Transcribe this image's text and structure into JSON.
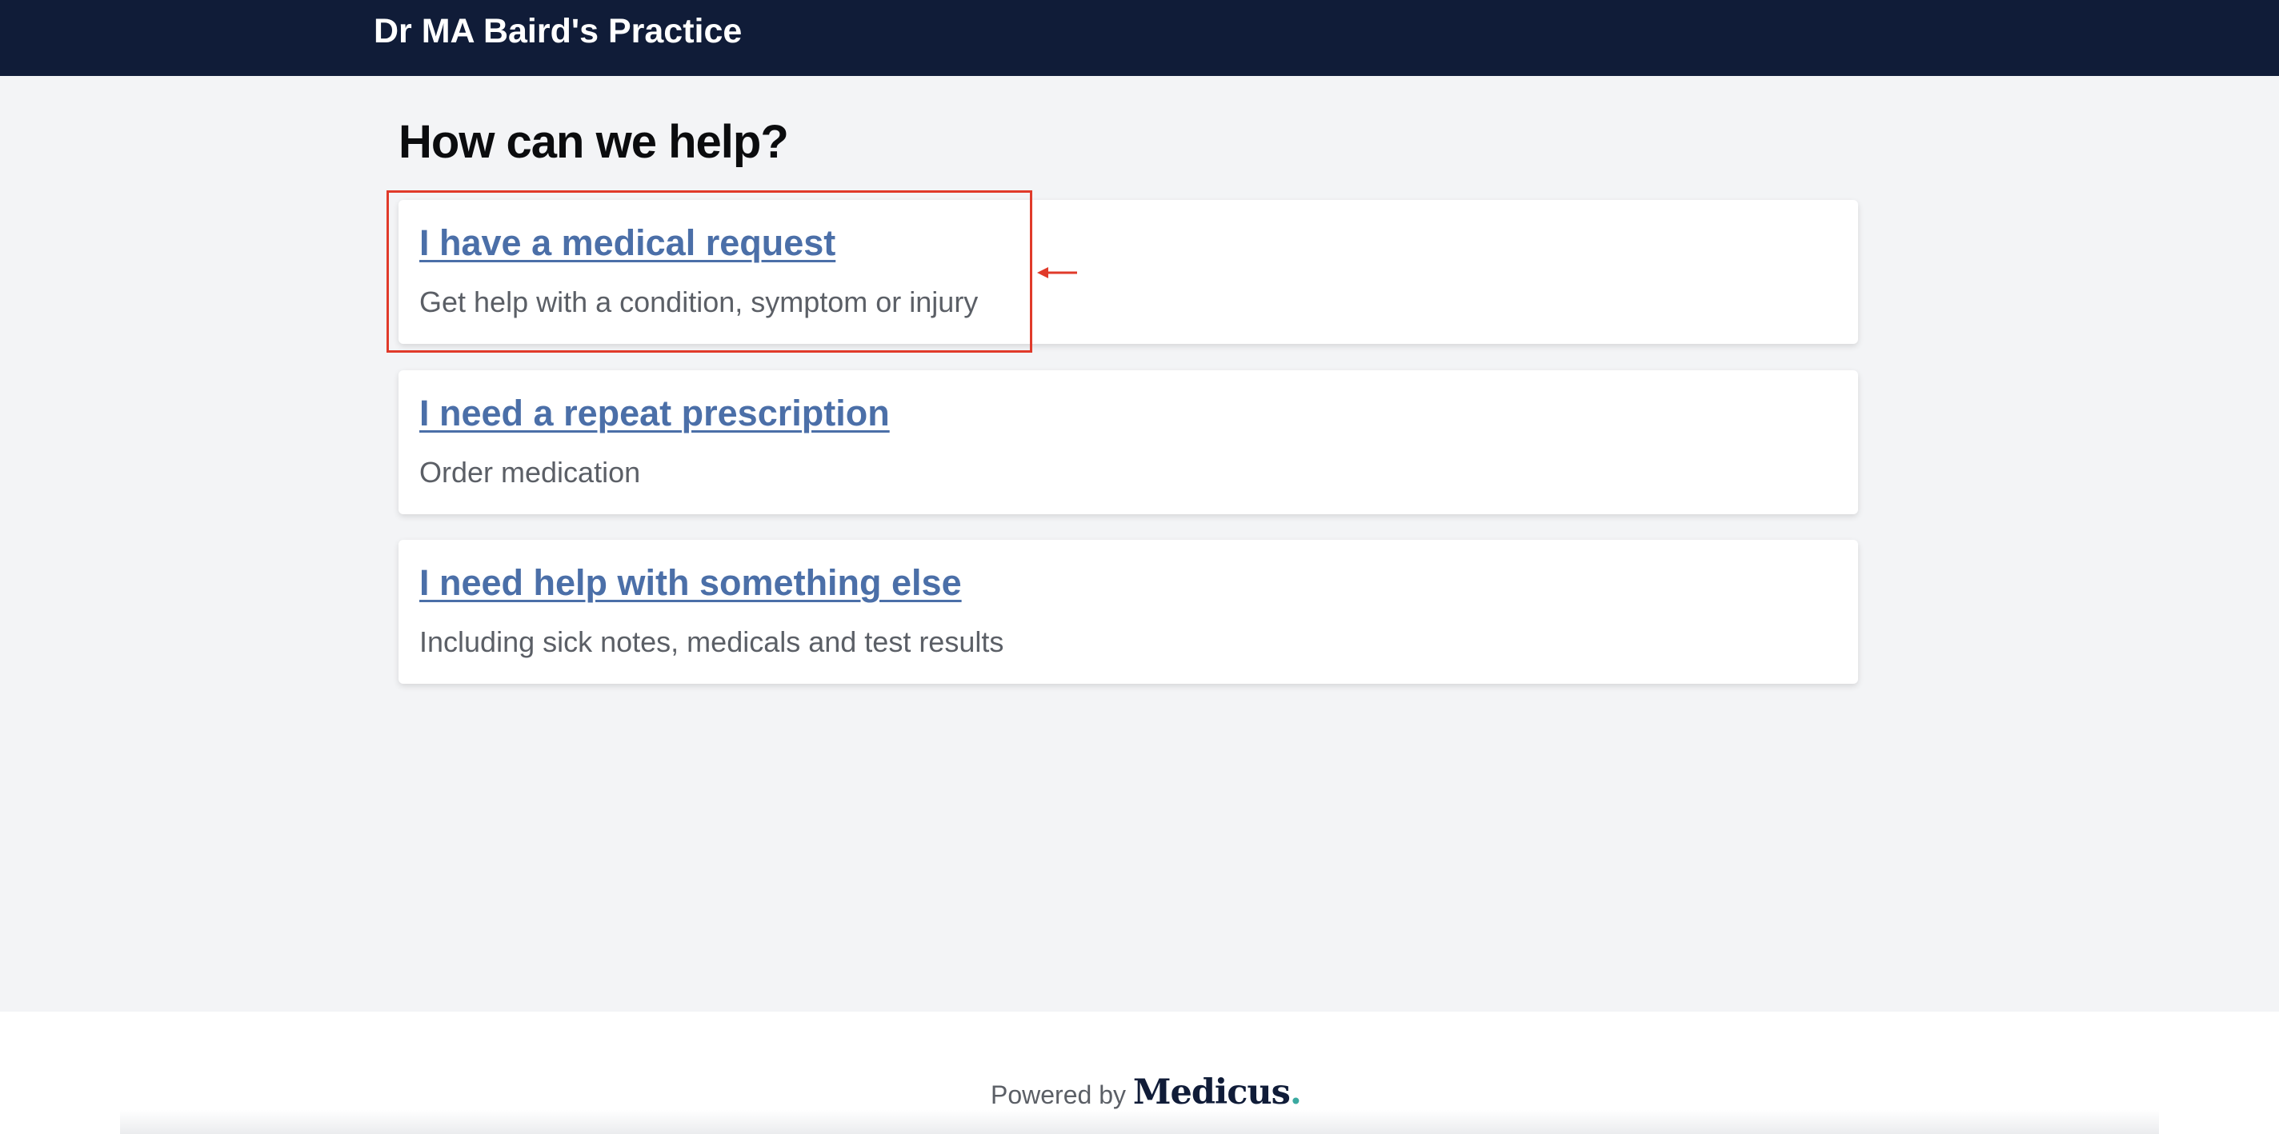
{
  "header": {
    "practice_name": "Dr MA Baird's Practice"
  },
  "main": {
    "title": "How can we help?",
    "options": [
      {
        "label": "I have a medical request",
        "description": "Get help with a condition, symptom or injury"
      },
      {
        "label": "I need a repeat prescription",
        "description": "Order medication"
      },
      {
        "label": "I need help with something else",
        "description": "Including sick notes, medicals and test results"
      }
    ]
  },
  "footer": {
    "powered_by": "Powered by",
    "brand": "Medicus",
    "brand_dot": "."
  },
  "colors": {
    "header_bg": "#101c38",
    "page_bg": "#f3f4f6",
    "link": "#4b6fa8",
    "highlight": "#e03a2a",
    "brand_dot": "#3aa9a0"
  },
  "icons": {
    "annotation_arrow": "left-arrow-icon"
  }
}
